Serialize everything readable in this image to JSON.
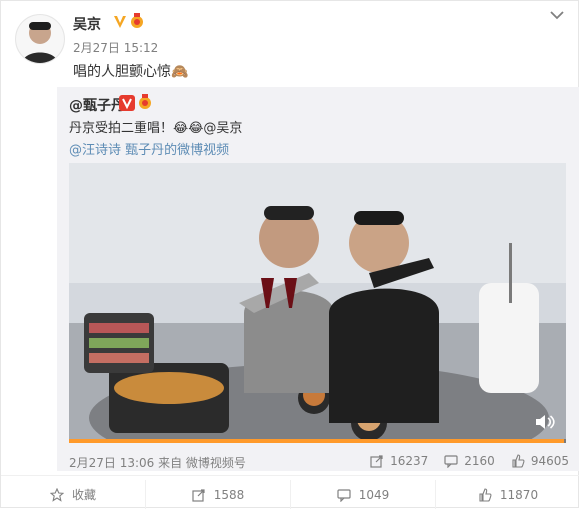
{
  "post": {
    "author": "吴京",
    "time": "2月27日 15:12",
    "text": "唱的人胆颤心惊🙈"
  },
  "repost": {
    "author": "@甄子丹",
    "text": "丹京受拍二重唱！😂😂@吴京",
    "links": "@汪诗诗  甄子丹的微博视频",
    "meta": "2月27日 13:06 来自 微博视频号",
    "stats": {
      "shares": "16237",
      "comments": "2160",
      "likes": "94605"
    },
    "video": {
      "progress": 0.995
    }
  },
  "actions": {
    "favorite": "收藏",
    "repost": "1588",
    "comment": "1049",
    "like": "11870"
  },
  "colors": {
    "link": "#5d8cb5",
    "meta": "#808080",
    "repost_bg": "#f2f2f5",
    "progress_fill": "#ff9a2b"
  }
}
